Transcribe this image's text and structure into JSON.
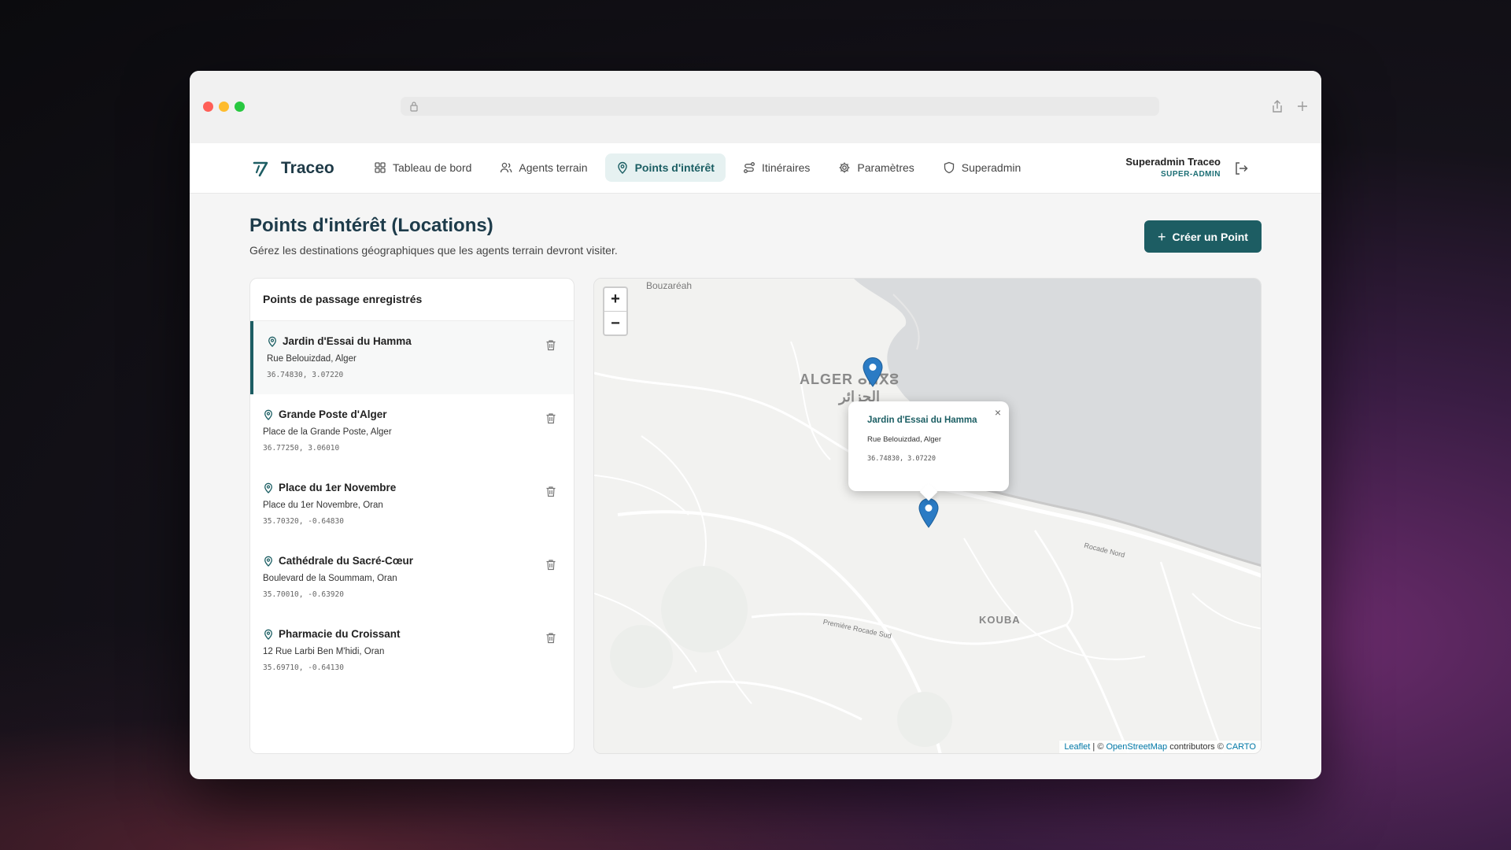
{
  "app": {
    "brand": "Traceo"
  },
  "nav": {
    "items": [
      {
        "label": "Tableau de bord",
        "icon": "grid-icon"
      },
      {
        "label": "Agents terrain",
        "icon": "users-icon"
      },
      {
        "label": "Points d'intérêt",
        "icon": "map-pin-icon",
        "active": true
      },
      {
        "label": "Itinéraires",
        "icon": "route-icon"
      },
      {
        "label": "Paramètres",
        "icon": "gear-icon"
      },
      {
        "label": "Superadmin",
        "icon": "shield-icon"
      }
    ]
  },
  "user": {
    "name": "Superadmin Traceo",
    "role": "SUPER-ADMIN"
  },
  "page": {
    "title": "Points d'intérêt (Locations)",
    "subtitle": "Gérez les destinations géographiques que les agents terrain devront visiter.",
    "create_label": "Créer un Point"
  },
  "list": {
    "header": "Points de passage enregistrés",
    "items": [
      {
        "name": "Jardin d'Essai du Hamma",
        "address": "Rue Belouizdad, Alger",
        "coords": "36.74830, 3.07220",
        "selected": true
      },
      {
        "name": "Grande Poste d'Alger",
        "address": "Place de la Grande Poste, Alger",
        "coords": "36.77250, 3.06010"
      },
      {
        "name": "Place du 1er Novembre",
        "address": "Place du 1er Novembre, Oran",
        "coords": "35.70320, -0.64830"
      },
      {
        "name": "Cathédrale du Sacré-Cœur",
        "address": "Boulevard de la Soummam, Oran",
        "coords": "35.70010, -0.63920"
      },
      {
        "name": "Pharmacie du Croissant",
        "address": "12 Rue Larbi Ben M'hidi, Oran",
        "coords": "35.69710, -0.64130"
      }
    ]
  },
  "map": {
    "zoom_in": "+",
    "zoom_out": "−",
    "labels": {
      "bouzareah": "Bouzaréah",
      "alger": "ALGER ⴰⵍⴳⵓ",
      "alger_ar": "الجزائر",
      "kouba": "KOUBA",
      "rocade": "Rocade Nord",
      "premiere_rocade": "Première Rocade Sud"
    },
    "popup": {
      "title": "Jardin d'Essai du Hamma",
      "address": "Rue Belouizdad, Alger",
      "coords": "36.74830, 3.07220",
      "close": "×"
    },
    "attribution": {
      "leaflet": "Leaflet",
      "sep1": " | © ",
      "osm": "OpenStreetMap",
      "mid": " contributors © ",
      "carto": "CARTO"
    }
  },
  "colors": {
    "accent": "#1d5d63",
    "marker": "#2b7bc4"
  }
}
